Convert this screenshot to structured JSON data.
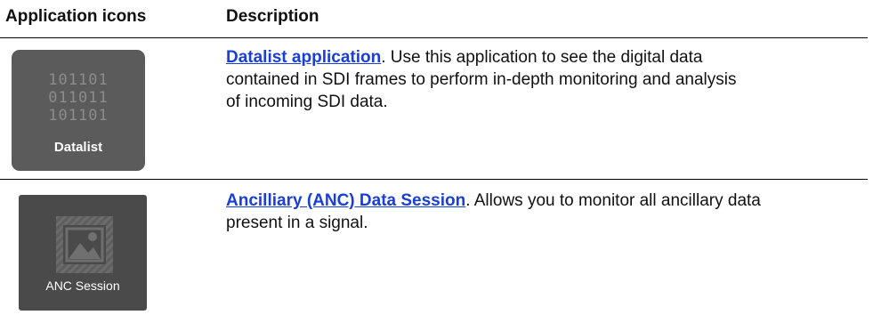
{
  "table": {
    "headers": {
      "icons": "Application icons",
      "description": "Description"
    },
    "rows": [
      {
        "icon": {
          "name": "datalist-icon",
          "bits": [
            "101101",
            "011011",
            "101101"
          ],
          "label": "Datalist"
        },
        "link_text": "Datalist application",
        "line1": ". Use this application to see the digital data",
        "line2": "contained in SDI frames to perform in-depth monitoring and analysis",
        "line3": "of incoming SDI data."
      },
      {
        "icon": {
          "name": "anc-session-icon",
          "label": "ANC Session"
        },
        "link_text": "Ancilliary (ANC) Data Session",
        "line1": ". Allows you to monitor all ancillary data",
        "line2": "present in a signal."
      }
    ]
  },
  "colors": {
    "link": "#1a3fd6",
    "datalist_icon_bg": "#5b5b5b",
    "anc_icon_bg": "#4a4a4a"
  }
}
